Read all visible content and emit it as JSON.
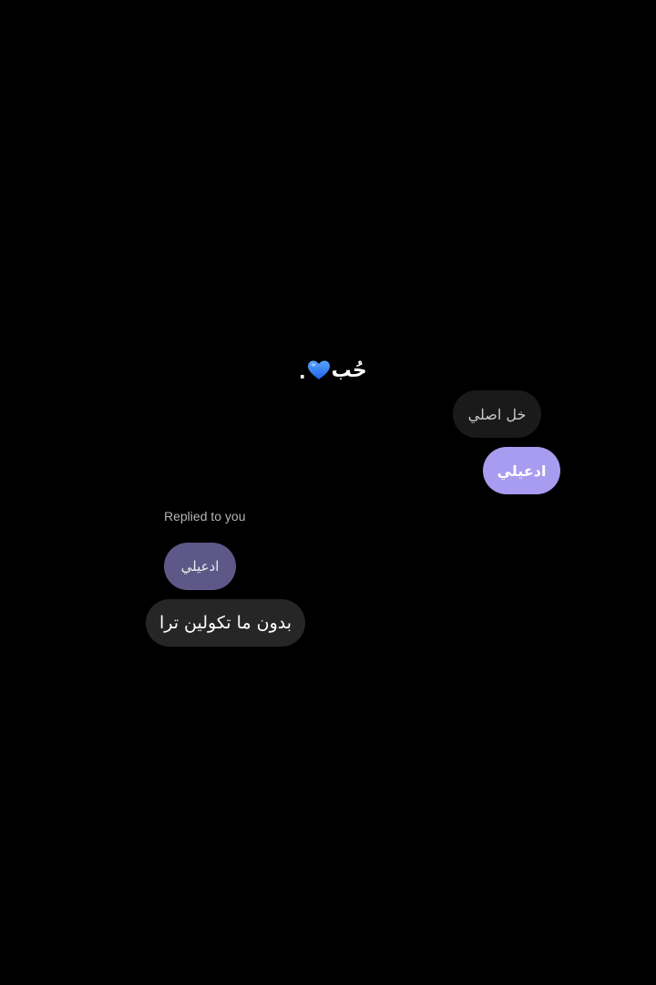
{
  "caption": {
    "text": "حُب",
    "dot": ".",
    "heart_icon": "blue-heart-icon",
    "heart_color": "#2a7bff"
  },
  "messages": [
    {
      "text": "خل اصلي",
      "side": "outgoing",
      "bg": "#1a1a1a"
    },
    {
      "text": "ادعيلي",
      "side": "outgoing",
      "bg": "#a89cf0"
    }
  ],
  "reply": {
    "label": "Replied to you",
    "quoted_text": "ادعيلي",
    "quoted_bg": "#5d5888",
    "text": "بدون ما تكولين ترا",
    "bg": "#262626"
  }
}
